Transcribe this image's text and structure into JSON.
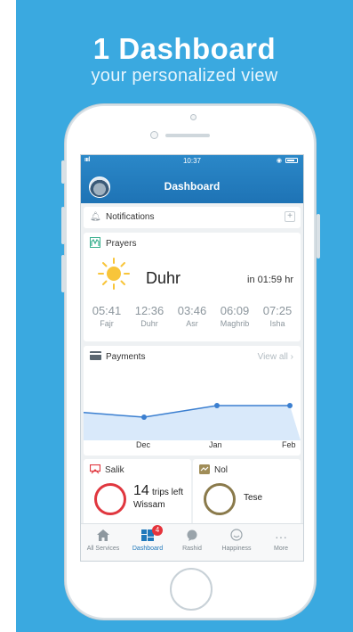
{
  "hero": {
    "title": "1 Dashboard",
    "subtitle": "your personalized view"
  },
  "status_bar": {
    "signal": "ıııl",
    "time": "10:37"
  },
  "app": {
    "title": "Dashboard"
  },
  "notifications": {
    "title": "Notifications",
    "add_symbol": "+"
  },
  "prayers": {
    "title": "Prayers",
    "current": "Duhr",
    "countdown": "in 01:59 hr",
    "times": [
      {
        "time": "05:41",
        "name": "Fajr"
      },
      {
        "time": "12:36",
        "name": "Duhr"
      },
      {
        "time": "03:46",
        "name": "Asr"
      },
      {
        "time": "06:09",
        "name": "Maghrib"
      },
      {
        "time": "07:25",
        "name": "Isha"
      }
    ]
  },
  "payments": {
    "title": "Payments",
    "view_all": "View all"
  },
  "chart_data": {
    "type": "area",
    "categories": [
      "Dec",
      "Jan",
      "Feb"
    ],
    "series": [
      {
        "values": [
          2.0,
          3.0,
          3.0
        ]
      }
    ],
    "ylim": [
      0,
      6
    ],
    "color": "#3b7fd0",
    "grid": false
  },
  "salik": {
    "title": "Salik",
    "trips_count": "14",
    "trips_label": "trips left",
    "name": "Wissam"
  },
  "nol": {
    "title": "Nol",
    "name": "Tese"
  },
  "tabs": [
    {
      "label": "All Services",
      "icon": "home-icon"
    },
    {
      "label": "Dashboard",
      "icon": "dashboard-icon",
      "badge": "4"
    },
    {
      "label": "Rashid",
      "icon": "chat-icon"
    },
    {
      "label": "Happiness",
      "icon": "smile-icon"
    },
    {
      "label": "More",
      "icon": "more-icon",
      "glyph": "···"
    }
  ],
  "colors": {
    "banner": "#3aa9e0",
    "appbar": "#1e73b5",
    "accent": "#1f78bb",
    "salik": "#e0373f",
    "nol": "#8a7a4b",
    "badge": "#e5333b"
  }
}
